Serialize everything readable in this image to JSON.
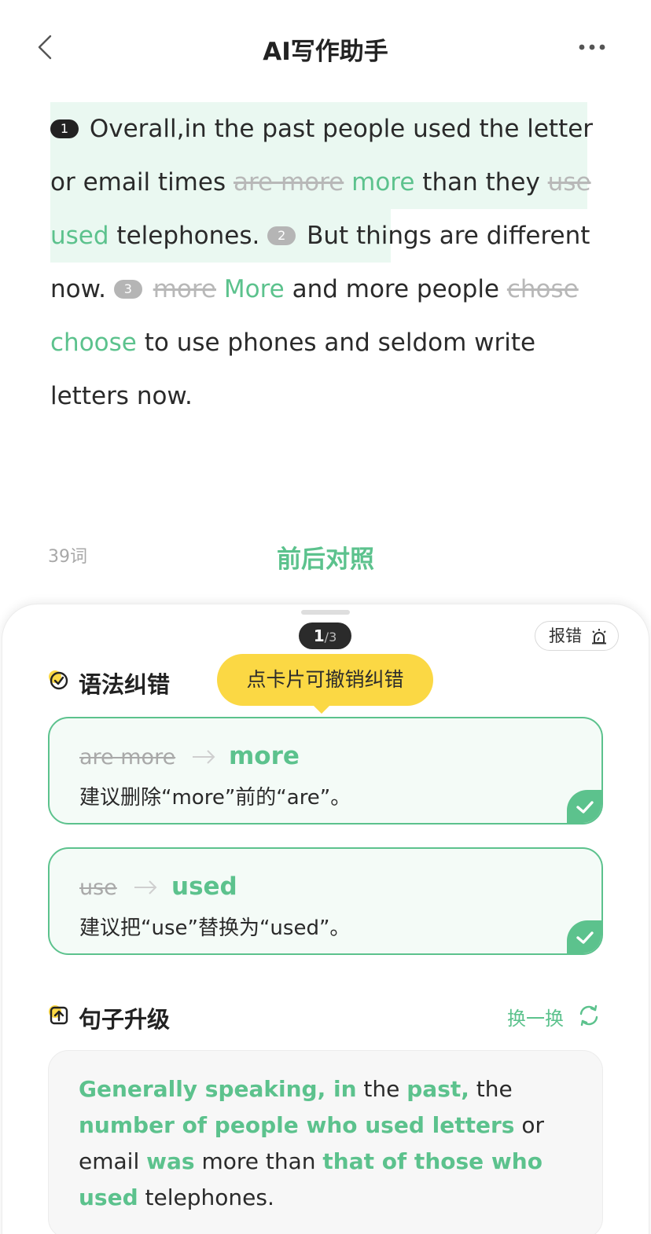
{
  "header": {
    "title": "AI写作助手",
    "back_icon": "chevron-left-icon",
    "more_icon": "more-dots-icon"
  },
  "essay": {
    "sentence1": {
      "num": "1",
      "a": "Overall,in the past people used the letter or email times ",
      "del1": "are more",
      "ins1": "more",
      "b": " than they ",
      "del2": "use",
      "ins2": "used",
      "c": " telephones. "
    },
    "sentence2": {
      "num": "2",
      "a": "But things are different now. "
    },
    "sentence3": {
      "num": "3",
      "del1": "more",
      "ins1": "More",
      "a": " and more people ",
      "del2": "chose",
      "ins2": "choose",
      "b": " to use phones and seldom write letters now."
    }
  },
  "footer": {
    "word_count": "39词",
    "compare_label": "前后对照"
  },
  "panel": {
    "pager": {
      "current": "1",
      "separator": "/",
      "total": "3"
    },
    "report_label": "报错",
    "grammar_title": "语法纠错",
    "tooltip": "点卡片可撤销纠错",
    "corrections": [
      {
        "original": "are more",
        "corrected": "more",
        "description": "建议删除“more”前的“are”。"
      },
      {
        "original": "use",
        "corrected": "used",
        "description": "建议把“use”替换为“used”。"
      }
    ],
    "upgrade_title": "句子升级",
    "swap_label": "换一换",
    "upgrade": {
      "p1": "Generally speaking, in",
      "p2": " the ",
      "p3": "past,",
      "p4": " the ",
      "p5": "number of people who used letters",
      "p6": " or email ",
      "p7": "was",
      "p8": " more than ",
      "p9": "that of those who used",
      "p10": " telephones."
    }
  },
  "colors": {
    "accent_green": "#5cc28d",
    "highlight_bg": "#eaf8f1",
    "tooltip_yellow": "#fbd844"
  }
}
